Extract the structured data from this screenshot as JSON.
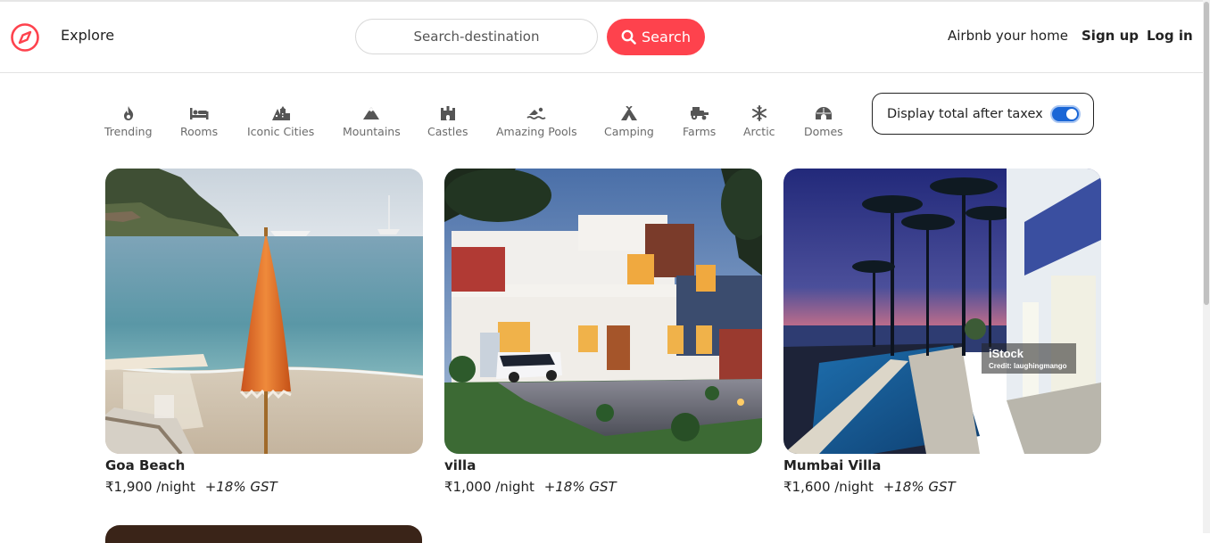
{
  "nav": {
    "explore": "Explore",
    "search_placeholder": "Search-destination",
    "search_button": "Search",
    "airbnb_home": "Airbnb your home",
    "signup": "Sign up",
    "login": "Log in"
  },
  "colors": {
    "brand": "#fe424d",
    "toggle_on": "#1a66d6"
  },
  "filters": [
    {
      "label": "Trending",
      "icon": "fire-icon"
    },
    {
      "label": "Rooms",
      "icon": "bed-icon"
    },
    {
      "label": "Iconic Cities",
      "icon": "city-icon"
    },
    {
      "label": "Mountains",
      "icon": "mountain-icon"
    },
    {
      "label": "Castles",
      "icon": "castle-icon"
    },
    {
      "label": "Amazing Pools",
      "icon": "swimmer-icon"
    },
    {
      "label": "Camping",
      "icon": "tent-icon"
    },
    {
      "label": "Farms",
      "icon": "tractor-icon"
    },
    {
      "label": "Arctic",
      "icon": "snowflake-icon"
    },
    {
      "label": "Domes",
      "icon": "igloo-icon"
    }
  ],
  "tax_toggle": {
    "label": "Display total after taxex",
    "on": true
  },
  "listings": [
    {
      "title": "Goa Beach",
      "price": "₹1,900 /night",
      "gst": "+18% GST"
    },
    {
      "title": "villa",
      "price": "₹1,000 /night",
      "gst": "+18% GST"
    },
    {
      "title": "Mumbai Villa",
      "price": "₹1,600 /night",
      "gst": "+18% GST"
    }
  ],
  "watermark": {
    "brand": "iStock",
    "credit": "Credit: laughingmango"
  }
}
